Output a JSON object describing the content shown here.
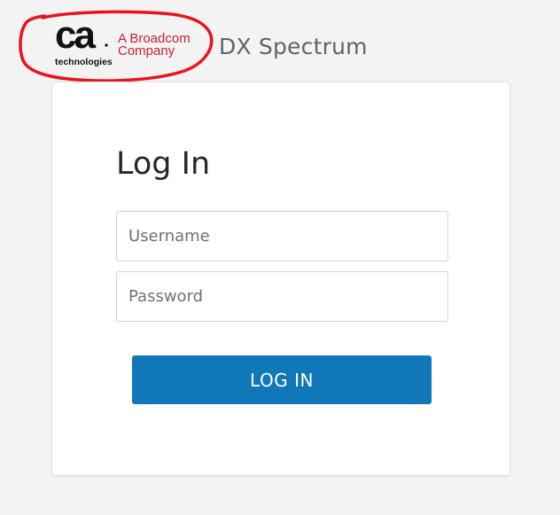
{
  "header": {
    "logo": {
      "mark": "ca",
      "subtext": "technologies",
      "tagline_line1": "A Broadcom",
      "tagline_line2": "Company"
    },
    "product_title": "DX Spectrum"
  },
  "login": {
    "heading": "Log In",
    "username_placeholder": "Username",
    "password_placeholder": "Password",
    "button_label": "LOG IN"
  },
  "colors": {
    "background": "#f3f3f3",
    "card": "#ffffff",
    "primary_button": "#1077b8",
    "brand_red": "#cc1f3a",
    "annotation_circle": "#e8141a"
  }
}
